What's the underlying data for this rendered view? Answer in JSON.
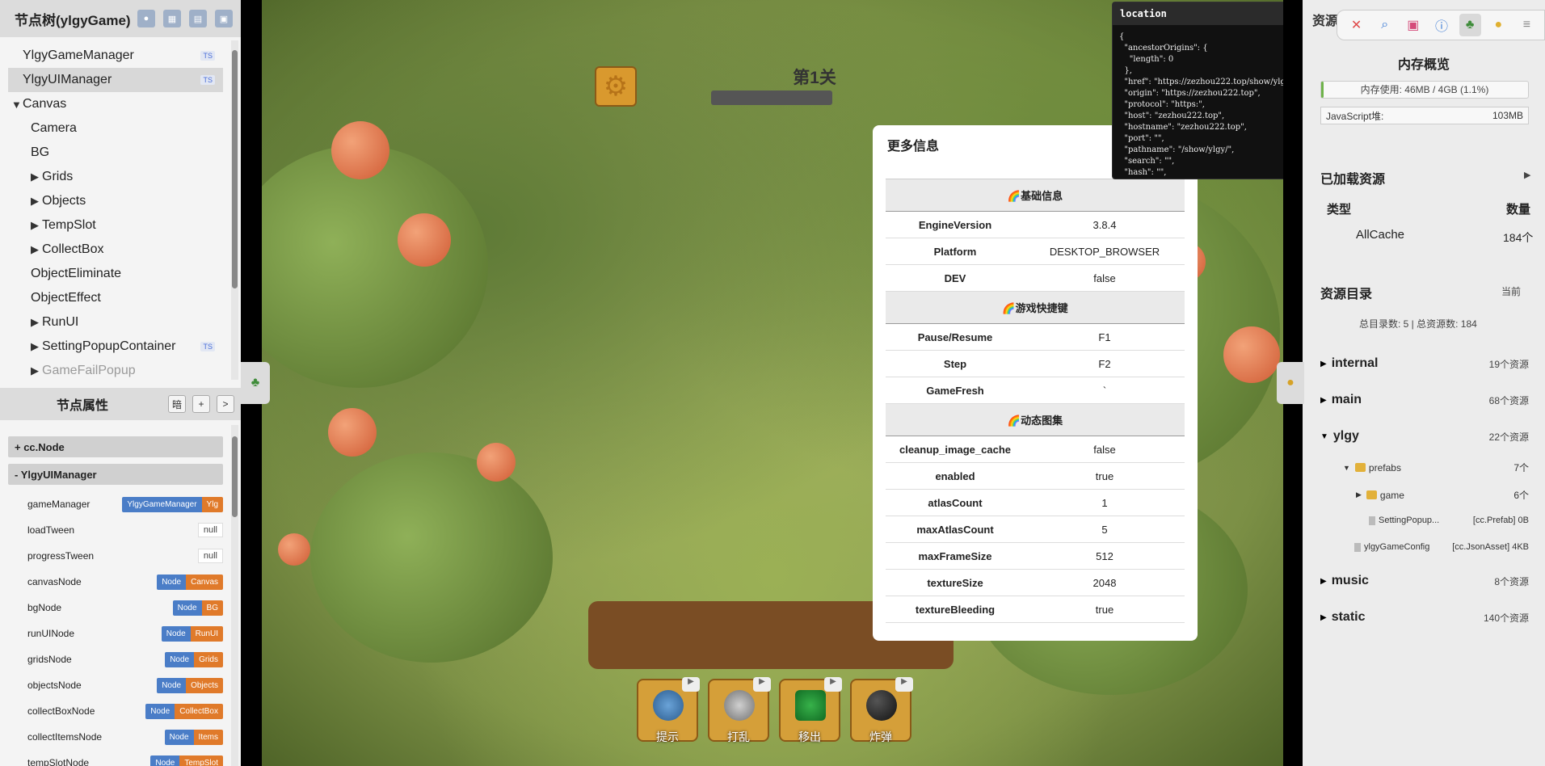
{
  "left_panel": {
    "title": "节点树(ylgyGame)",
    "header_icons": [
      "user-icon",
      "image-icon",
      "chart-icon",
      "picture-icon"
    ],
    "tree": [
      {
        "label": "YlgyGameManager",
        "ts": "TS",
        "caret": ""
      },
      {
        "label": "YlgyUIManager",
        "ts": "TS",
        "caret": "",
        "selected": true
      },
      {
        "label": "Canvas",
        "ts": "",
        "caret": "▼"
      },
      {
        "label": "Camera",
        "ts": "",
        "caret": ""
      },
      {
        "label": "BG",
        "ts": "",
        "caret": ""
      },
      {
        "label": "Grids",
        "ts": "",
        "caret": "▶"
      },
      {
        "label": "Objects",
        "ts": "",
        "caret": "▶"
      },
      {
        "label": "TempSlot",
        "ts": "",
        "caret": "▶"
      },
      {
        "label": "CollectBox",
        "ts": "",
        "caret": "▶"
      },
      {
        "label": "ObjectEliminate",
        "ts": "",
        "caret": ""
      },
      {
        "label": "ObjectEffect",
        "ts": "",
        "caret": ""
      },
      {
        "label": "RunUI",
        "ts": "",
        "caret": "▶"
      },
      {
        "label": "SettingPopupContainer",
        "ts": "TS",
        "caret": "▶"
      },
      {
        "label": "GameFailPopup",
        "ts": "",
        "caret": "▶",
        "dim": true
      }
    ],
    "props_title": "节点属性",
    "props_buttons": [
      "暗",
      "+",
      ">"
    ],
    "sections": {
      "cc_node": "+ cc.Node",
      "ui_manager": "- YlgyUIManager"
    },
    "props": [
      {
        "key": "gameManager",
        "node": "YlgyGameManager",
        "name": "Ylg"
      },
      {
        "key": "loadTween",
        "null": "null"
      },
      {
        "key": "progressTween",
        "null": "null"
      },
      {
        "key": "canvasNode",
        "node": "Node",
        "name": "Canvas"
      },
      {
        "key": "bgNode",
        "node": "Node",
        "name": "BG"
      },
      {
        "key": "runUINode",
        "node": "Node",
        "name": "RunUI"
      },
      {
        "key": "gridsNode",
        "node": "Node",
        "name": "Grids"
      },
      {
        "key": "objectsNode",
        "node": "Node",
        "name": "Objects"
      },
      {
        "key": "collectBoxNode",
        "node": "Node",
        "name": "CollectBox"
      },
      {
        "key": "collectItemsNode",
        "node": "Node",
        "name": "Items"
      },
      {
        "key": "tempSlotNode",
        "node": "Node",
        "name": "TempSlot"
      }
    ]
  },
  "game": {
    "level_title": "第1关",
    "tools": [
      "提示",
      "打乱",
      "移出",
      "炸弹"
    ]
  },
  "modal": {
    "title": "更多信息",
    "sections": [
      {
        "title": "🌈基础信息",
        "rows": [
          [
            "EngineVersion",
            "3.8.4"
          ],
          [
            "Platform",
            "DESKTOP_BROWSER"
          ],
          [
            "DEV",
            "false"
          ]
        ]
      },
      {
        "title": "🌈游戏快捷键",
        "rows": [
          [
            "Pause/Resume",
            "F1"
          ],
          [
            "Step",
            "F2"
          ],
          [
            "GameFresh",
            "`"
          ]
        ]
      },
      {
        "title": "🌈动态图集",
        "rows": [
          [
            "cleanup_image_cache",
            "false"
          ],
          [
            "enabled",
            "true"
          ],
          [
            "atlasCount",
            "1"
          ],
          [
            "maxAtlasCount",
            "5"
          ],
          [
            "maxFrameSize",
            "512"
          ],
          [
            "textureSize",
            "2048"
          ],
          [
            "textureBleeding",
            "true"
          ]
        ]
      }
    ]
  },
  "location_popup": {
    "title": "location",
    "close": "✕",
    "json_text": "{\n  \"ancestorOrigins\": {\n    \"length\": 0\n  },\n  \"href\": \"https://zezhou222.top/show/ylgy/\",\n  \"origin\": \"https://zezhou222.top\",\n  \"protocol\": \"https:\",\n  \"host\": \"zezhou222.top\",\n  \"hostname\": \"zezhou222.top\",\n  \"port\": \"\",\n  \"pathname\": \"/show/ylgy/\",\n  \"search\": \"\",\n  \"hash\": \"\","
  },
  "right_panel": {
    "title": "资源",
    "toolbar_icons": [
      "close-icon",
      "search-icon",
      "toolbox-icon",
      "info-icon",
      "tree-icon",
      "bulb-icon",
      "menu-icon"
    ],
    "memory_title": "内存概览",
    "memory_usage": "内存使用: 46MB / 4GB (1.1%)",
    "memory_fraction": 0.011,
    "js_heap_label": "JavaScript堆:",
    "js_heap_value": "103MB",
    "loaded_title": "已加载资源",
    "loaded_arrow": "▶",
    "type_header": "类型",
    "count_header": "数量",
    "allcache_label": "AllCache",
    "allcache_count": "184个",
    "dir_title": "资源目录",
    "dir_current": "当前",
    "dir_summary": "总目录数: 5 | 总资源数: 184",
    "dirs": [
      {
        "name": "internal",
        "count": "19个资源",
        "caret": "▶"
      },
      {
        "name": "main",
        "count": "68个资源",
        "caret": "▶"
      },
      {
        "name": "ylgy",
        "count": "22个资源",
        "caret": "▼"
      },
      {
        "name": "music",
        "count": "8个资源",
        "caret": "▶"
      },
      {
        "name": "static",
        "count": "140个资源",
        "caret": "▶"
      }
    ],
    "ylgy_children": {
      "prefabs": {
        "label": "prefabs",
        "count": "7个",
        "caret": "▼"
      },
      "game": {
        "label": "game",
        "count": "6个",
        "caret": "▶"
      },
      "setting": {
        "label": "SettingPopup...",
        "meta": "[cc.Prefab] 0B"
      },
      "config": {
        "label": "ylgyGameConfig",
        "meta": "[cc.JsonAsset] 4KB"
      }
    }
  }
}
